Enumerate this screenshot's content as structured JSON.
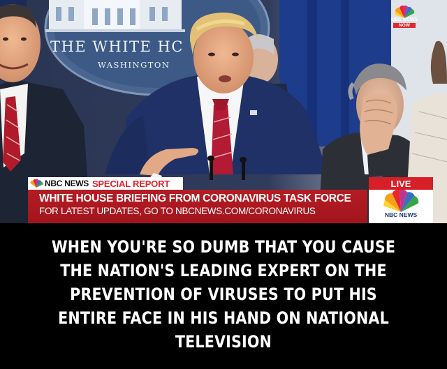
{
  "photo": {
    "seal": {
      "title": "THE WHITE HC",
      "subtitle": "WASHINGTON"
    },
    "corner_logo": {
      "icon": "nbc-peacock-icon",
      "network": "NBC NEWS",
      "tag": "NOW"
    },
    "ticker": {
      "brand_icon": "nbc-peacock-icon",
      "brand_network": "NBC NEWS",
      "brand_special": "SPECIAL REPORT",
      "headline": "WHITE HOUSE BRIEFING FROM CORONAVIRUS TASK FORCE",
      "subline": "FOR LATEST UPDATES, GO TO NBCNEWS.COM/CORONAVIRUS",
      "live_label": "LIVE",
      "logo_icon": "nbc-peacock-icon",
      "logo_text": "NBC NEWS"
    }
  },
  "caption": {
    "text": "WHEN YOU'RE SO DUMB THAT YOU CAUSE THE NATION'S LEADING EXPERT ON THE PREVENTION OF VIRUSES TO PUT HIS ENTIRE FACE IN HIS HAND ON NATIONAL TELEVISION"
  },
  "colors": {
    "ticker_red": "#b51c24",
    "live_red": "#d61f26",
    "backdrop_blue": "#27324d",
    "suit_navy": "#1e2f5e"
  }
}
